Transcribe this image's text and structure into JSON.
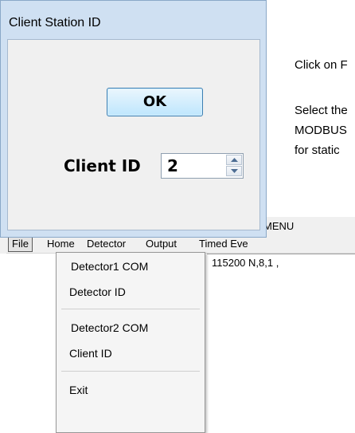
{
  "document": {
    "line1": "Click on F",
    "line2": "Select the",
    "line3": "MODBUS",
    "line4": "for static"
  },
  "app": {
    "title_fragment": "R MENU",
    "menu": {
      "file": "File",
      "home": "Home",
      "detector": "Detector",
      "output": "Output",
      "timed": "Timed Eve"
    },
    "status_text": "115200 N,8,1 ,"
  },
  "dropdown": {
    "items": [
      "Detector1 COM",
      "Detector ID",
      "Detector2 COM",
      "Client ID",
      "Exit"
    ]
  },
  "dialog": {
    "title": "Client Station ID",
    "ok_label": "OK",
    "client_label": "Client ID",
    "client_value": "2"
  },
  "icons": {
    "spin_up": "chevron-up-icon",
    "spin_down": "chevron-down-icon"
  }
}
